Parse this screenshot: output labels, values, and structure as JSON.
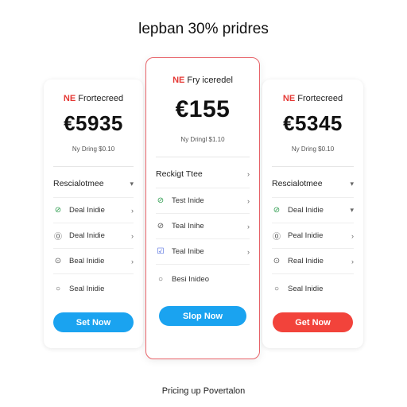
{
  "page": {
    "title": "lepban 30% pridres",
    "footer": "Pricing up Povertalon"
  },
  "colors": {
    "accent_red": "#e53935",
    "button_blue": "#1aa3f0",
    "button_red": "#f2433b",
    "featured_border": "#e8646a",
    "check_green": "#2e9d4f"
  },
  "plans": [
    {
      "tag_accent": "NE",
      "tag_text": " Frortecreed",
      "price": "€5935",
      "subtext": "Ny Dring $0.10",
      "header": "Rescialotmee",
      "header_chevron": "chevron-down-icon",
      "features": [
        {
          "icon": "check-circle-icon",
          "label": "Deal Inidie",
          "chevron": "chevron-right-icon"
        },
        {
          "icon": "question-circle-icon",
          "label": "Deal Inidie",
          "chevron": "chevron-right-icon"
        },
        {
          "icon": "help-circle-icon",
          "label": "Beal Inidie",
          "chevron": "chevron-right-icon"
        },
        {
          "icon": "search-icon",
          "label": "Seal Inidie",
          "chevron": ""
        }
      ],
      "button_label": "Set Now",
      "button_color": "#1aa3f0"
    },
    {
      "tag_accent": "NE",
      "tag_text": " Fry iceredel",
      "price": "€155",
      "subtext": "Ny Dringl $1.10",
      "header": "Reckigt Ttee",
      "header_chevron": "chevron-right-icon",
      "features": [
        {
          "icon": "check-circle-icon",
          "label": "Test Inide",
          "chevron": "chevron-right-icon"
        },
        {
          "icon": "check-circle-icon",
          "label": "Teal Inihe",
          "chevron": "chevron-right-icon"
        },
        {
          "icon": "checkbox-icon",
          "label": "Teal Inibe",
          "chevron": "chevron-right-icon"
        },
        {
          "icon": "search-icon",
          "label": "Besi Inideo",
          "chevron": ""
        }
      ],
      "button_label": "Slop Now",
      "button_color": "#1aa3f0"
    },
    {
      "tag_accent": "NE",
      "tag_text": " Frortecreed",
      "price": "€5345",
      "subtext": "Ny Dring $0.10",
      "header": "Rescialotmee",
      "header_chevron": "chevron-down-icon",
      "features": [
        {
          "icon": "check-circle-icon",
          "label": "Deal Inidie",
          "chevron": "chevron-down-icon"
        },
        {
          "icon": "question-circle-icon",
          "label": "Peal Inidie",
          "chevron": "chevron-right-icon"
        },
        {
          "icon": "help-circle-icon",
          "label": "Real Inidie",
          "chevron": "chevron-right-icon"
        },
        {
          "icon": "search-icon",
          "label": "Seal Inidie",
          "chevron": ""
        }
      ],
      "button_label": "Get Now",
      "button_color": "#f2433b"
    }
  ]
}
